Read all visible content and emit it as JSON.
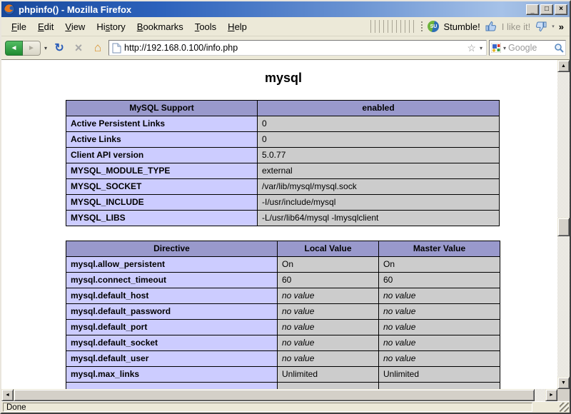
{
  "window": {
    "title": "phpinfo() - Mozilla Firefox",
    "status": "Done"
  },
  "menu_bar": {
    "items": [
      {
        "label": "File",
        "underline": 0
      },
      {
        "label": "Edit",
        "underline": 0
      },
      {
        "label": "View",
        "underline": 0
      },
      {
        "label": "History",
        "underline": 2
      },
      {
        "label": "Bookmarks",
        "underline": 0
      },
      {
        "label": "Tools",
        "underline": 0
      },
      {
        "label": "Help",
        "underline": 0
      }
    ]
  },
  "stumbleupon_toolbar": {
    "badge": "SU",
    "stumble_label": "Stumble!",
    "like_label": "I like it!"
  },
  "nav_toolbar": {
    "url": "http://192.168.0.100/info.php",
    "search_placeholder": "Google"
  },
  "icons": {
    "minimize": "_",
    "maximize": "□",
    "close": "×",
    "back": "◄",
    "forward": "►",
    "nav_dropdown": "▾",
    "reload": "↻",
    "stop": "×",
    "home": "⌂",
    "bookmark_star": "☆",
    "url_dropdown": "▾",
    "search_dropdown": "▾",
    "overflow_chevron": "»",
    "scroll_up": "▲",
    "scroll_down": "▼",
    "scroll_left": "◄",
    "scroll_right": "►"
  },
  "page": {
    "heading": "mysql",
    "support_table": {
      "headers": [
        "MySQL Support",
        "enabled"
      ],
      "col_widths": [
        "268px",
        "339px"
      ],
      "rows": [
        [
          "Active Persistent Links",
          "0"
        ],
        [
          "Active Links",
          "0"
        ],
        [
          "Client API version",
          "5.0.77"
        ],
        [
          "MYSQL_MODULE_TYPE",
          "external"
        ],
        [
          "MYSQL_SOCKET",
          "/var/lib/mysql/mysql.sock"
        ],
        [
          "MYSQL_INCLUDE",
          "-I/usr/include/mysql"
        ],
        [
          "MYSQL_LIBS",
          "-L/usr/lib64/mysql -lmysqlclient"
        ]
      ]
    },
    "directive_table": {
      "headers": [
        "Directive",
        "Local Value",
        "Master Value"
      ],
      "col_widths": [
        "296px",
        "142px",
        "170px"
      ],
      "rows": [
        [
          "mysql.allow_persistent",
          "On",
          "On"
        ],
        [
          "mysql.connect_timeout",
          "60",
          "60"
        ],
        [
          "mysql.default_host",
          "no value",
          "no value"
        ],
        [
          "mysql.default_password",
          "no value",
          "no value"
        ],
        [
          "mysql.default_port",
          "no value",
          "no value"
        ],
        [
          "mysql.default_socket",
          "no value",
          "no value"
        ],
        [
          "mysql.default_user",
          "no value",
          "no value"
        ],
        [
          "mysql.max_links",
          "Unlimited",
          "Unlimited"
        ],
        [
          "",
          "",
          ""
        ]
      ]
    }
  },
  "colors": {
    "titlebar_blue": "#2d62bc",
    "toolbar_bg": "#ece9d8",
    "phpinfo_header_bg": "#9999cc",
    "phpinfo_label_bg": "#ccccff",
    "phpinfo_value_bg": "#cccccc",
    "back_button_green": "#2f9b41",
    "su_green": "#6eb43c",
    "su_blue": "#2e6eb5"
  }
}
